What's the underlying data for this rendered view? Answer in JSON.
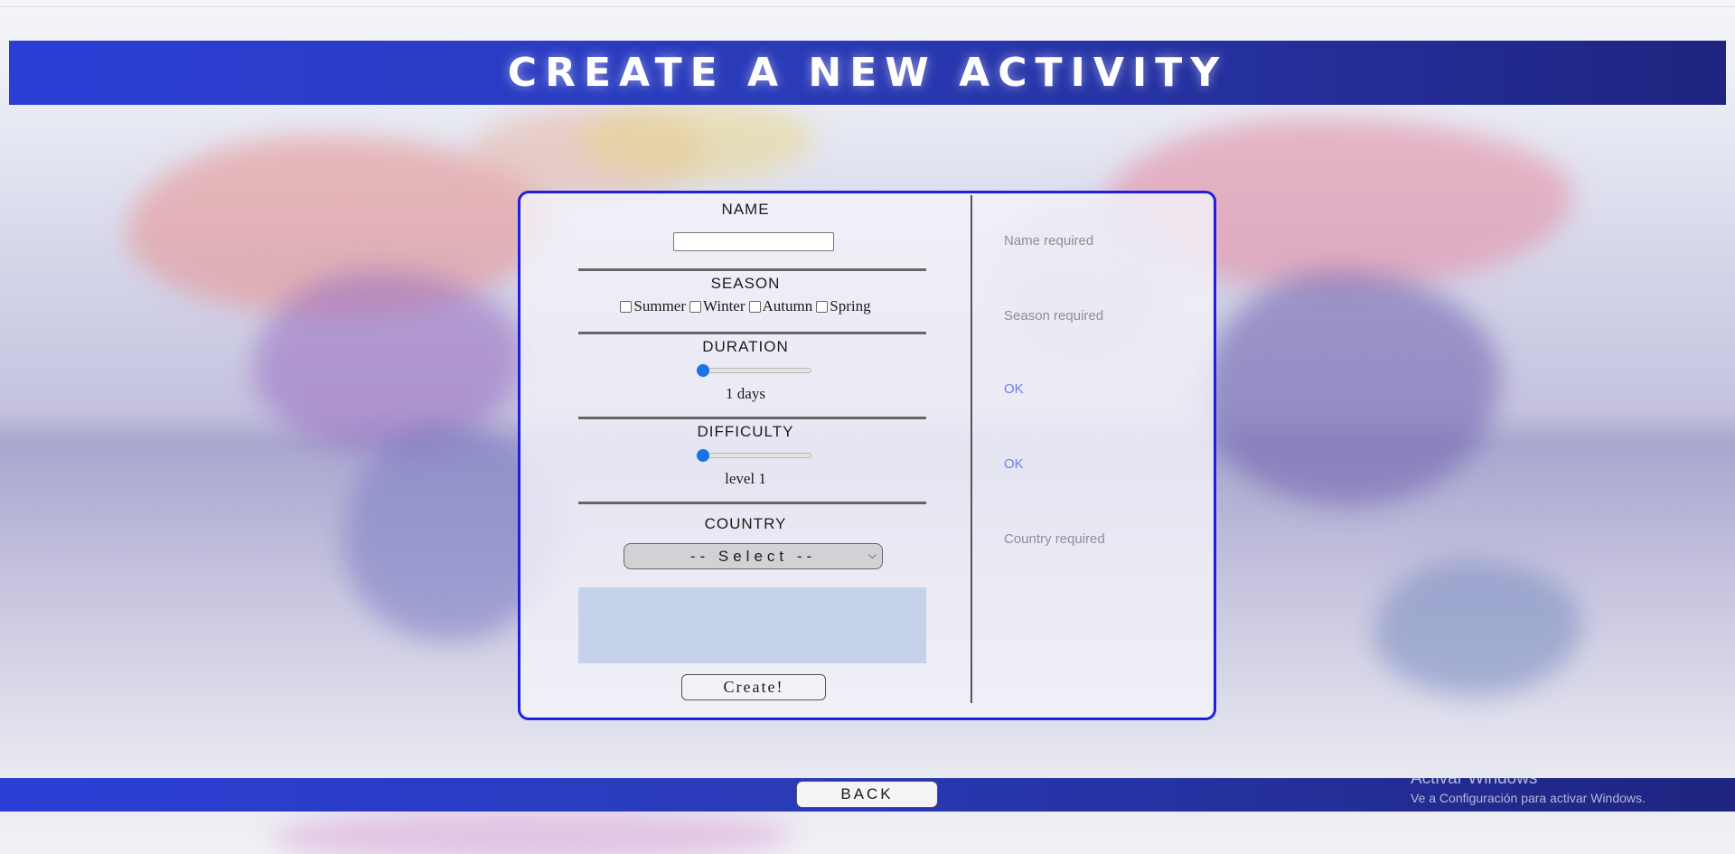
{
  "header": {
    "title": "CREATE A NEW ACTIVITY"
  },
  "form": {
    "name_label": "NAME",
    "name_value": "",
    "season_label": "SEASON",
    "seasons": [
      "Summer",
      "Winter",
      "Autumn",
      "Spring"
    ],
    "duration_label": "DURATION",
    "duration_value": 1,
    "duration_text": "1 days",
    "difficulty_label": "DIFFICULTY",
    "difficulty_value": 1,
    "difficulty_text": "level 1",
    "country_label": "COUNTRY",
    "country_selected": "-- Select --",
    "create_label": "Create!"
  },
  "validation": {
    "name": "Name required",
    "season": "Season required",
    "duration": "OK",
    "difficulty": "OK",
    "country": "Country required"
  },
  "footer": {
    "back_label": "BACK"
  },
  "watermark": {
    "line1": "Activar Windows",
    "line2": "Ve a Configuración para activar Windows."
  },
  "colors": {
    "header_blue": "#2a3ed6",
    "card_border": "#1f1fe0",
    "ok_text": "#6e7ef0",
    "slider_thumb": "#1a73e8"
  }
}
